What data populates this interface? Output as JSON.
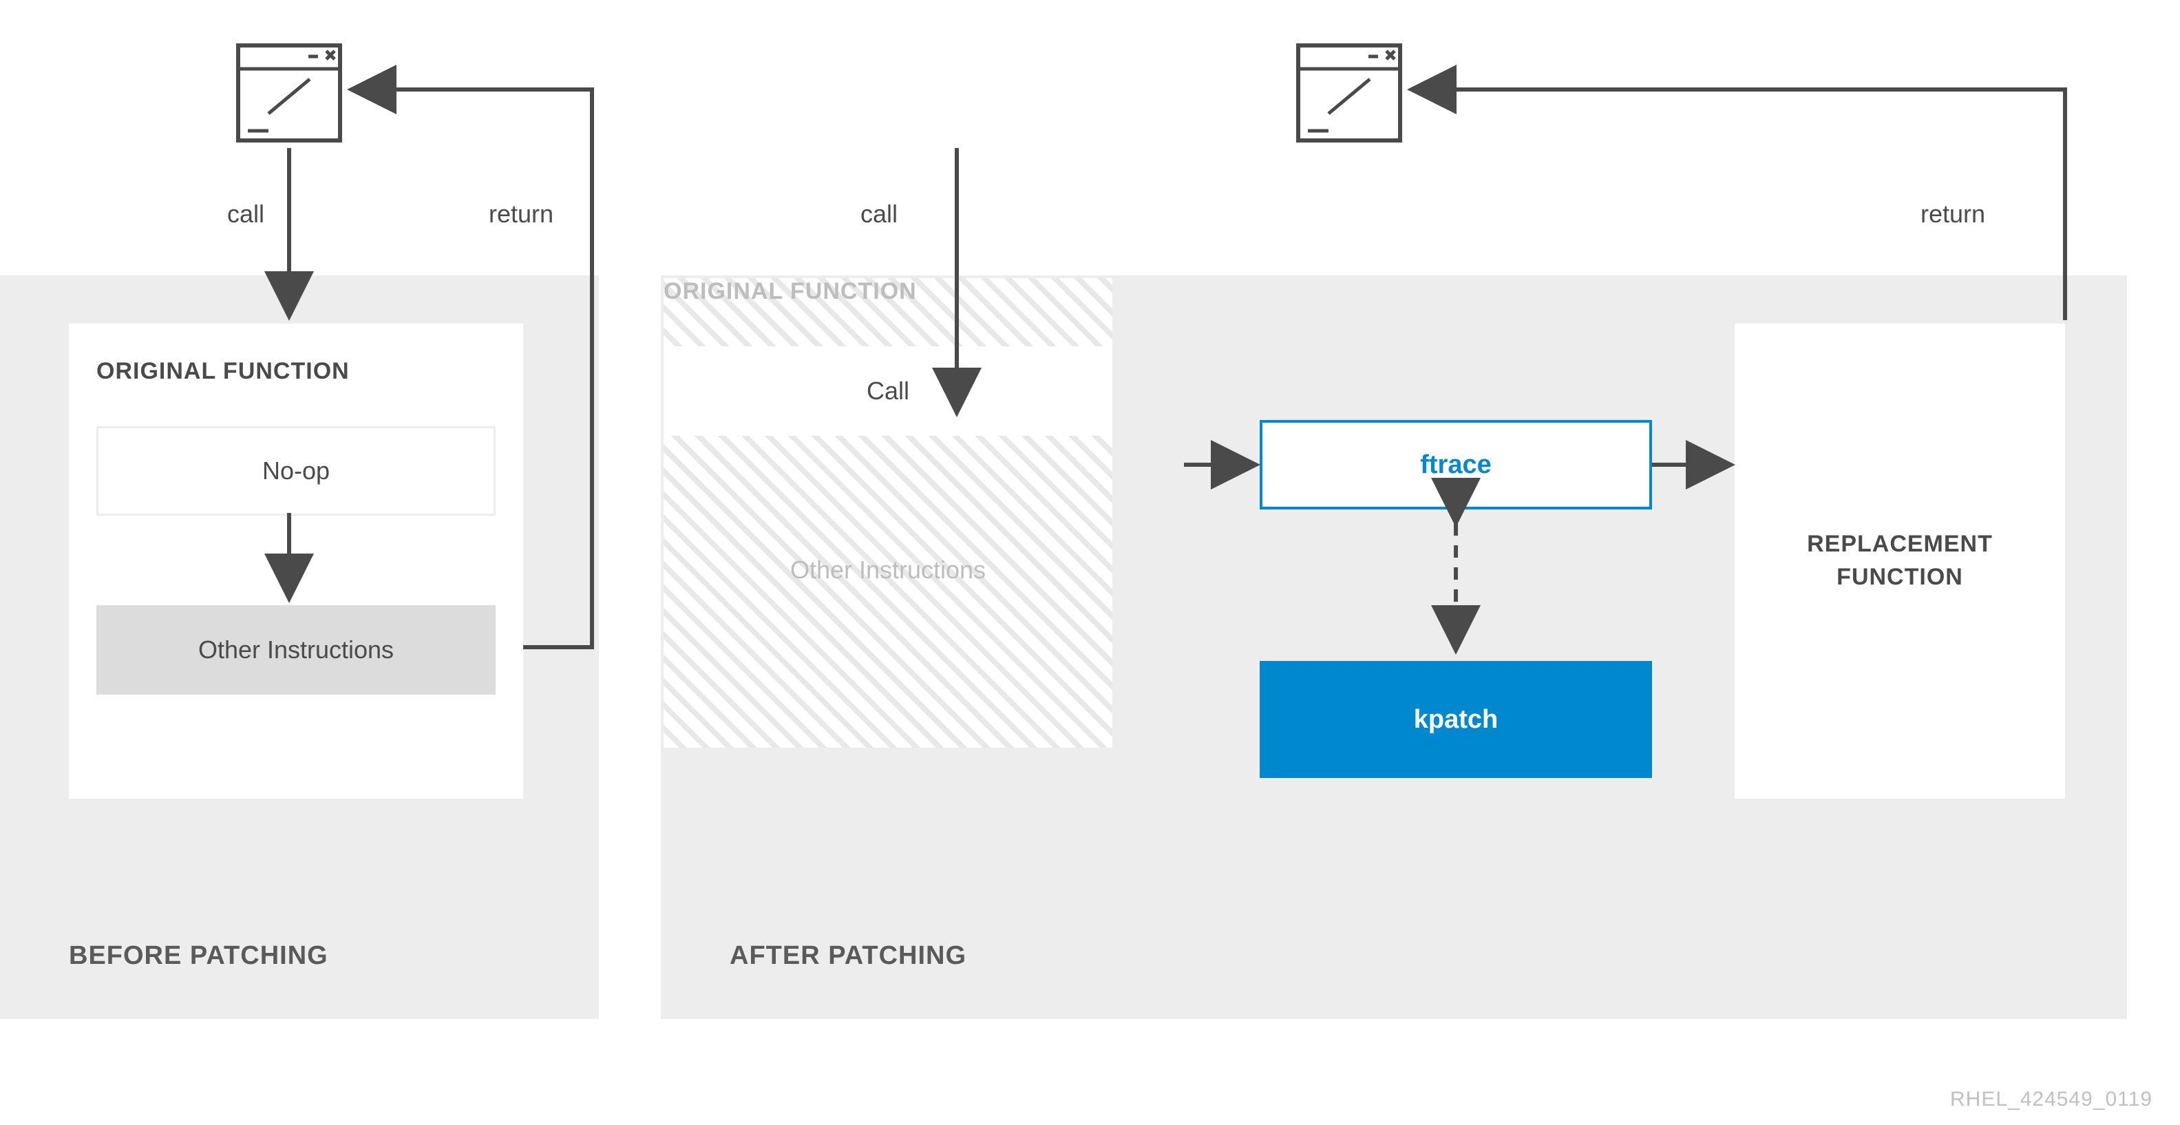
{
  "left": {
    "title": "BEFORE PATCHING",
    "orig_title": "ORIGINAL FUNCTION",
    "noop": "No-op",
    "other": "Other Instructions",
    "call_label": "call",
    "return_label": "return"
  },
  "right": {
    "title": "AFTER PATCHING",
    "orig_title": "ORIGINAL FUNCTION",
    "call_box": "Call",
    "other": "Other Instructions",
    "ftrace": "ftrace",
    "kpatch": "kpatch",
    "replace_line1": "REPLACEMENT",
    "replace_line2": "FUNCTION",
    "call_label": "call",
    "return_label": "return"
  },
  "footer": "RHEL_424549_0119",
  "colors": {
    "accent": "#0088ce",
    "panel": "#ededed",
    "text": "#4a4a4a"
  }
}
